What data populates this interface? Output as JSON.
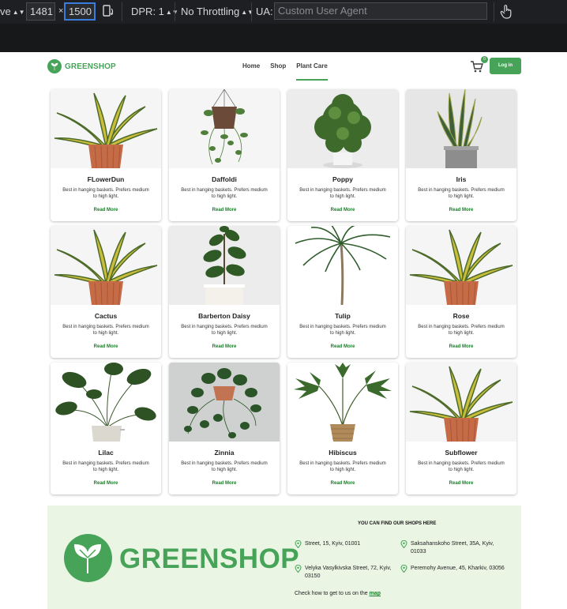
{
  "devtools": {
    "mode_suffix": "ve",
    "width": "1481",
    "height": "1500",
    "dimension_sep": "×",
    "dpr": "DPR: 1",
    "throttling": "No Throttling",
    "ua_label": "UA:",
    "ua_placeholder": "Custom User Agent",
    "icons": [
      "rotate-device-icon",
      "touch-simulation-icon"
    ]
  },
  "site": {
    "brand": "GREENSHOP",
    "nav": [
      "Home",
      "Shop",
      "Plant Care"
    ],
    "active_nav": "Plant Care",
    "cart_count": "0",
    "login_label": "Log in",
    "accent_color": "#46a358"
  },
  "products": [
    {
      "title": "FLowerDun",
      "desc": "Best in hanging baskets. Prefers medium to high light.",
      "more": "Read More",
      "image": "snake-plant-terracotta"
    },
    {
      "title": "Daffoldi",
      "desc": "Best in hanging baskets. Prefers medium to high light.",
      "more": "Read More",
      "image": "hanging-ivy"
    },
    {
      "title": "Poppy",
      "desc": "Best in hanging baskets. Prefers medium to high light.",
      "more": "Read More",
      "image": "bushy-shrub"
    },
    {
      "title": "Iris",
      "desc": "Best in hanging baskets. Prefers medium to high light.",
      "more": "Read More",
      "image": "sansevieria-grey-pot"
    },
    {
      "title": "Cactus",
      "desc": "Best in hanging baskets. Prefers medium to high light.",
      "more": "Read More",
      "image": "snake-plant-terracotta"
    },
    {
      "title": "Barberton Daisy",
      "desc": "Best in hanging baskets. Prefers medium to high light.",
      "more": "Read More",
      "image": "fiddle-leaf-fig"
    },
    {
      "title": "Tulip",
      "desc": "Best in hanging baskets. Prefers medium to high light.",
      "more": "Read More",
      "image": "dracaena-tree"
    },
    {
      "title": "Rose",
      "desc": "Best in hanging baskets. Prefers medium to high light.",
      "more": "Read More",
      "image": "snake-plant-terracotta"
    },
    {
      "title": "Lilac",
      "desc": "Best in hanging baskets. Prefers medium to high light.",
      "more": "Read More",
      "image": "large-leaf-plant"
    },
    {
      "title": "Zinnia",
      "desc": "Best in hanging baskets. Prefers medium to high light.",
      "more": "Read More",
      "image": "hanging-pothos"
    },
    {
      "title": "Hibiscus",
      "desc": "Best in hanging baskets. Prefers medium to high light.",
      "more": "Read More",
      "image": "palm-basket"
    },
    {
      "title": "Subflower",
      "desc": "Best in hanging baskets. Prefers medium to high light.",
      "more": "Read More",
      "image": "snake-plant-terracotta"
    }
  ],
  "footer": {
    "brand": "GREENSHOP",
    "heading": "YOU CAN FIND OUR SHOPS HERE",
    "addresses": [
      "Street, 15, Kyiv, 01001",
      "Saksahanskoho Street, 35A, Kyiv, 01033",
      "Velyka Vasylkivska Street, 72, Kyiv, 03150",
      "Peremohy Avenue, 45, Kharkiv, 03056"
    ],
    "hint": "Check how to get to us on the",
    "map_link": "map"
  }
}
